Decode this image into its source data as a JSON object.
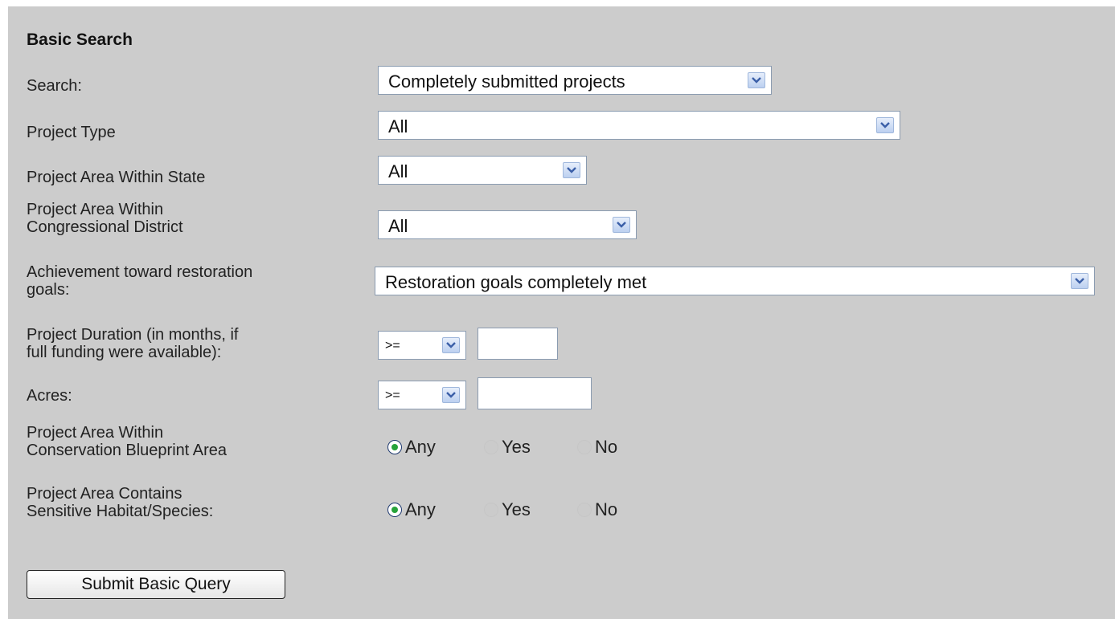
{
  "form": {
    "title": "Basic Search",
    "search": {
      "label": "Search:",
      "value": "Completely submitted projects"
    },
    "project_type": {
      "label": "Project Type",
      "value": "All"
    },
    "area_state": {
      "label": "Project Area Within State",
      "value": "All"
    },
    "area_district": {
      "label_line1": "Project Area Within",
      "label_line2": "Congressional District",
      "value": "All"
    },
    "achievement": {
      "label_line1": "Achievement toward restoration",
      "label_line2": "goals:",
      "value": "Restoration goals completely met"
    },
    "duration": {
      "label_line1": "Project Duration (in months, if",
      "label_line2": "full funding were available):",
      "operator": ">=",
      "value": ""
    },
    "acres": {
      "label": "Acres:",
      "operator": ">=",
      "value": ""
    },
    "blueprint": {
      "label_line1": "Project Area Within",
      "label_line2": "Conservation Blueprint Area",
      "options": [
        "Any",
        "Yes",
        "No"
      ],
      "selected": "Any"
    },
    "sensitive": {
      "label_line1": "Project Area Contains",
      "label_line2": "Sensitive Habitat/Species:",
      "options": [
        "Any",
        "Yes",
        "No"
      ],
      "selected": "Any"
    },
    "submit_label": "Submit Basic Query"
  },
  "colors": {
    "panel_background": "#cccccc",
    "radio_checked_dot": "#27a33a",
    "dropdown_arrow": "#3b5fa8"
  }
}
